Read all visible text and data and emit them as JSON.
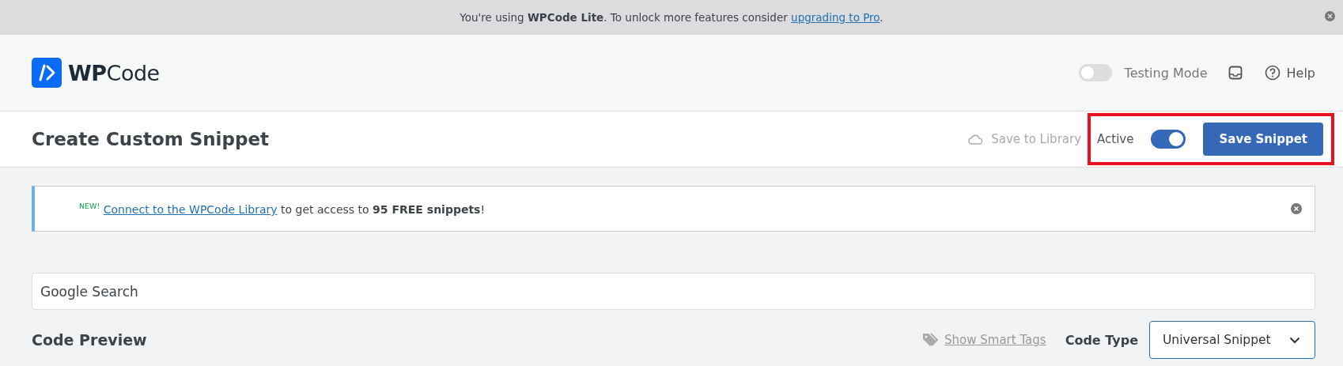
{
  "promo_bar": {
    "text": "You're using **WPCode Lite**. To unlock more features consider",
    "link": "upgrading to Pro",
    "suffix": "."
  },
  "header": {
    "logo": "**WP**Code",
    "testing_mode": {
      "label": "Testing Mode",
      "on": false
    },
    "help": "Help"
  },
  "title_bar": {
    "title": "Create Custom Snippet",
    "save_to_library": "Save to Library",
    "active": {
      "label": "Active",
      "on": true
    },
    "save_button": "Save Snippet",
    "highlighted": true
  },
  "notice": {
    "badge": "NEW!",
    "link": "Connect to the WPCode Library",
    "text": "to get access to **95 FREE snippets**!"
  },
  "snippet_title": {
    "value": "Google Search"
  },
  "code_preview": {
    "heading": "Code Preview",
    "smart_tags": "Show Smart Tags",
    "code_type_label": "Code Type",
    "code_type": "Universal Snippet"
  }
}
